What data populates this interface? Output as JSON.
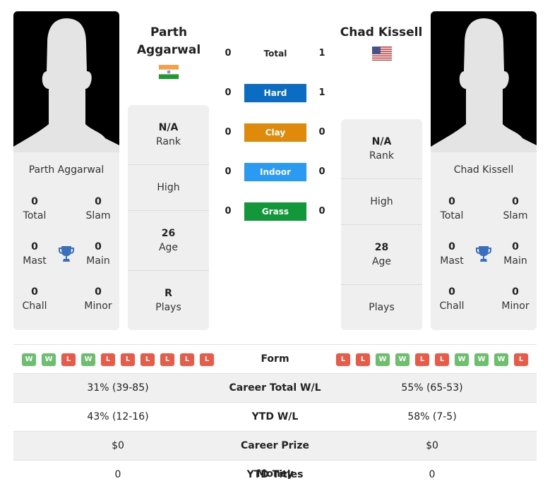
{
  "colors": {
    "hard": "#0a6cc2",
    "clay": "#e08a0b",
    "indoor": "#2a9af2",
    "grass": "#13973b",
    "win": "#6cbf6c",
    "loss": "#ea5a47",
    "trophy": "#3a6fc0"
  },
  "player1": {
    "name_line1": "Parth",
    "name_line2": "Aggarwal",
    "full_name": "Parth Aggarwal",
    "country_flag": "india-flag",
    "titles": {
      "total": {
        "value": "0",
        "label": "Total"
      },
      "slam": {
        "value": "0",
        "label": "Slam"
      },
      "mast": {
        "value": "0",
        "label": "Mast"
      },
      "main": {
        "value": "0",
        "label": "Main"
      },
      "chall": {
        "value": "0",
        "label": "Chall"
      },
      "minor": {
        "value": "0",
        "label": "Minor"
      }
    },
    "info": {
      "rank": {
        "value": "N/A",
        "label": "Rank"
      },
      "high": {
        "value": "",
        "label": "High"
      },
      "age": {
        "value": "26",
        "label": "Age"
      },
      "plays": {
        "value": "R",
        "label": "Plays"
      }
    },
    "form": [
      "W",
      "W",
      "L",
      "W",
      "L",
      "L",
      "L",
      "L",
      "L",
      "L"
    ]
  },
  "player2": {
    "name": "Chad Kissell",
    "full_name": "Chad Kissell",
    "country_flag": "usa-flag",
    "titles": {
      "total": {
        "value": "0",
        "label": "Total"
      },
      "slam": {
        "value": "0",
        "label": "Slam"
      },
      "mast": {
        "value": "0",
        "label": "Mast"
      },
      "main": {
        "value": "0",
        "label": "Main"
      },
      "chall": {
        "value": "0",
        "label": "Chall"
      },
      "minor": {
        "value": "0",
        "label": "Minor"
      }
    },
    "info": {
      "rank": {
        "value": "N/A",
        "label": "Rank"
      },
      "high": {
        "value": "",
        "label": "High"
      },
      "age": {
        "value": "28",
        "label": "Age"
      },
      "plays": {
        "value": "",
        "label": "Plays"
      }
    },
    "form": [
      "L",
      "L",
      "W",
      "W",
      "L",
      "L",
      "W",
      "W",
      "W",
      "L"
    ]
  },
  "h2h": [
    {
      "label": "Total",
      "p1": "0",
      "p2": "1",
      "type": "total"
    },
    {
      "label": "Hard",
      "p1": "0",
      "p2": "1",
      "type": "hard"
    },
    {
      "label": "Clay",
      "p1": "0",
      "p2": "0",
      "type": "clay"
    },
    {
      "label": "Indoor",
      "p1": "0",
      "p2": "0",
      "type": "indoor"
    },
    {
      "label": "Grass",
      "p1": "0",
      "p2": "0",
      "type": "grass"
    }
  ],
  "stats": {
    "form_label": "Form",
    "rows": [
      {
        "label": "Career Total W/L",
        "p1": "31% (39-85)",
        "p2": "55% (65-53)"
      },
      {
        "label": "YTD W/L",
        "p1": "43% (12-16)",
        "p2": "58% (7-5)"
      },
      {
        "label": "Career Prize Money",
        "p1": "$0",
        "p2": "$0"
      },
      {
        "label": "YTD Titles",
        "p1": "0",
        "p2": "0"
      }
    ]
  }
}
